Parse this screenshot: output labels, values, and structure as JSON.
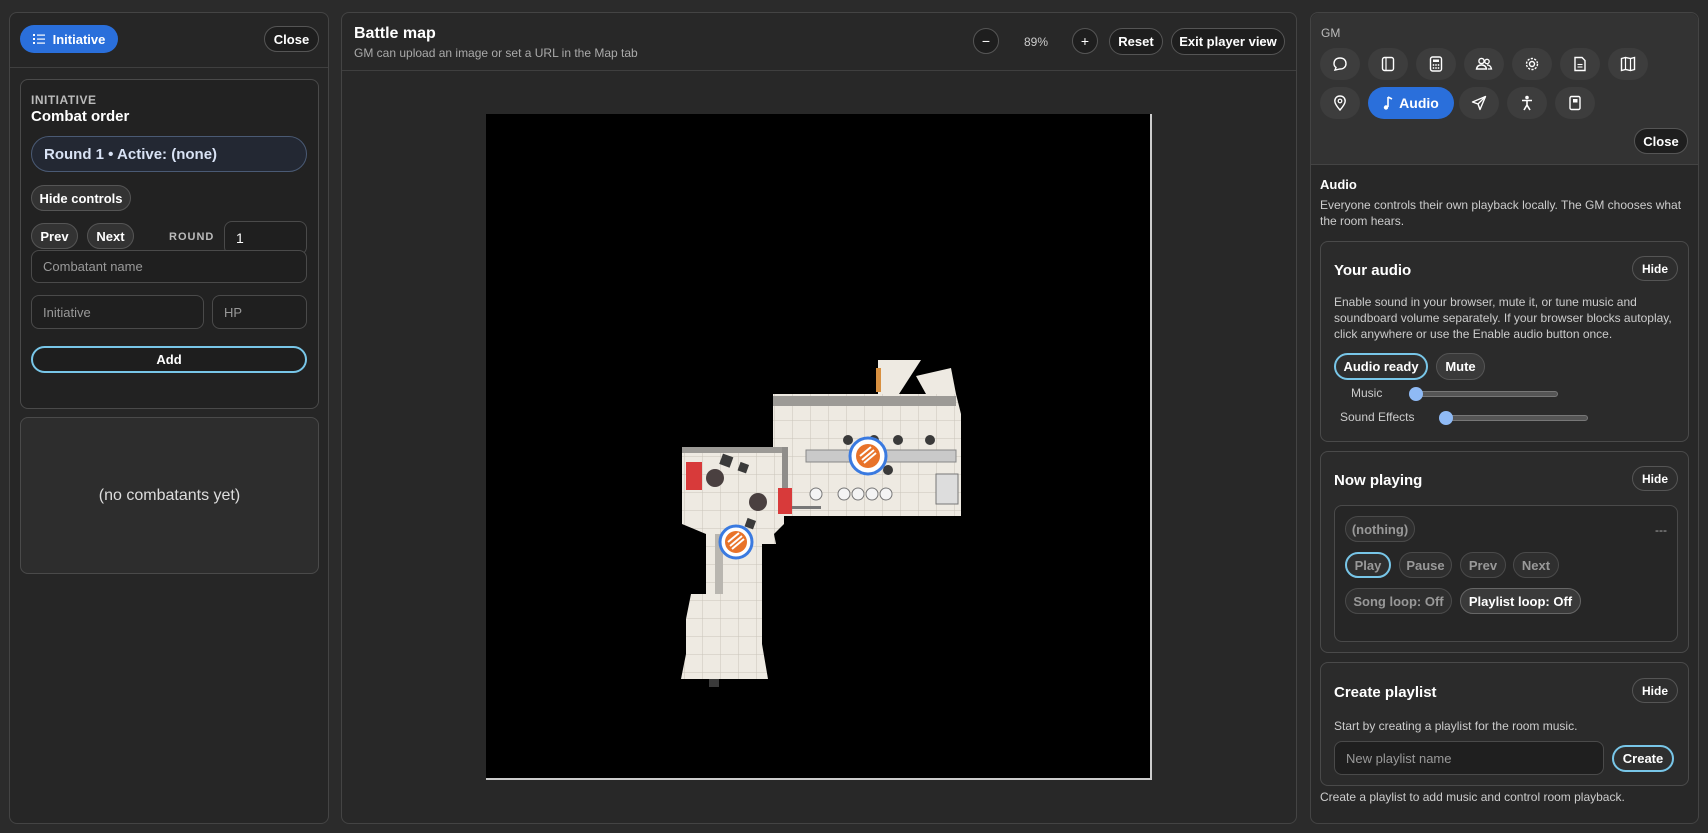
{
  "left": {
    "initiative_label": "Initiative",
    "close_label": "Close",
    "section_label": "INITIATIVE",
    "title": "Combat order",
    "round_status": "Round 1 • Active: (none)",
    "hide_controls": "Hide controls",
    "prev": "Prev",
    "next": "Next",
    "round_label": "ROUND",
    "round_value": "1",
    "name_placeholder": "Combatant name",
    "initiative_placeholder": "Initiative",
    "hp_placeholder": "HP",
    "add_label": "Add",
    "empty_text": "(no combatants yet)"
  },
  "center": {
    "title": "Battle map",
    "subtitle": "GM can upload an image or set a URL in the Map tab",
    "zoom_out": "−",
    "zoom_value": "89%",
    "zoom_in": "+",
    "reset": "Reset",
    "exit": "Exit player view"
  },
  "right": {
    "gm_label": "GM",
    "audio_tab": "Audio",
    "close_label": "Close",
    "audio_title": "Audio",
    "audio_desc": "Everyone controls their own playback locally. The GM chooses what the room hears.",
    "your_audio": {
      "title": "Your audio",
      "hide": "Hide",
      "desc": "Enable sound in your browser, mute it, or tune music and soundboard volume separately. If your browser blocks autoplay, click anywhere or use the Enable audio button once.",
      "ready": "Audio ready",
      "mute": "Mute",
      "music_label": "Music",
      "music_level": 0,
      "sfx_label": "Sound Effects",
      "sfx_level": 0
    },
    "now_playing": {
      "title": "Now playing",
      "hide": "Hide",
      "track": "(nothing)",
      "time": "---",
      "play": "Play",
      "pause": "Pause",
      "prev": "Prev",
      "next": "Next",
      "song_loop": "Song loop: Off",
      "playlist_loop": "Playlist loop: Off"
    },
    "create_playlist": {
      "title": "Create playlist",
      "hide": "Hide",
      "desc": "Start by creating a playlist for the room music.",
      "placeholder": "New playlist name",
      "create": "Create"
    },
    "footer": "Create a playlist to add music and control room playback."
  },
  "colors": {
    "accent": "#2a6fdb",
    "outline": "#78c6e8",
    "token": "#e8732a"
  }
}
